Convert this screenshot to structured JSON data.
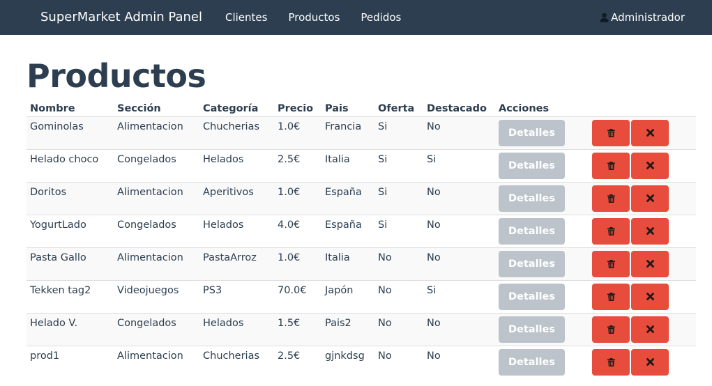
{
  "navbar": {
    "brand": "SuperMarket Admin Panel",
    "links": [
      "Clientes",
      "Productos",
      "Pedidos"
    ],
    "user": "Administrador",
    "user_icon": "user-icon"
  },
  "page": {
    "title": "Productos"
  },
  "table": {
    "headers": [
      "Nombre",
      "Sección",
      "Categoría",
      "Precio",
      "Pais",
      "Oferta",
      "Destacado",
      "Acciones"
    ],
    "details_label": "Detalles",
    "delete_icon": "trash-icon",
    "remove_icon": "close-icon",
    "rows": [
      [
        "Gominolas",
        "Alimentacion",
        "Chucherias",
        "1.0€",
        "Francia",
        "Si",
        "No"
      ],
      [
        "Helado choco",
        "Congelados",
        "Helados",
        "2.5€",
        "Italia",
        "Si",
        "Si"
      ],
      [
        "Doritos",
        "Alimentacion",
        "Aperitivos",
        "1.0€",
        "España",
        "Si",
        "No"
      ],
      [
        "YogurtLado",
        "Congelados",
        "Helados",
        "4.0€",
        "España",
        "Si",
        "No"
      ],
      [
        "Pasta Gallo",
        "Alimentacion",
        "PastaArroz",
        "1.0€",
        "Italia",
        "No",
        "No"
      ],
      [
        "Tekken tag2",
        "Videojuegos",
        "PS3",
        "70.0€",
        "Japón",
        "No",
        "Si"
      ],
      [
        "Helado V.",
        "Congelados",
        "Helados",
        "1.5€",
        "Pais2",
        "No",
        "No"
      ],
      [
        "prod1",
        "Alimentacion",
        "Chucherias",
        "2.5€",
        "gjnkdsg",
        "No",
        "No"
      ]
    ]
  },
  "colors": {
    "navbar": "#2c3e50",
    "danger": "#e74c3c",
    "details": "#bcc3ca"
  }
}
